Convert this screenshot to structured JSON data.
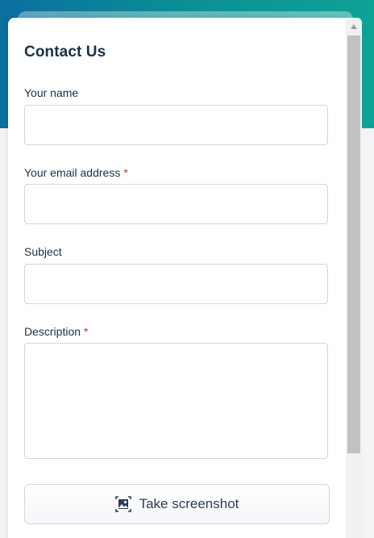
{
  "form": {
    "title": "Contact Us",
    "fields": {
      "name": {
        "label": "Your name",
        "required": false,
        "value": ""
      },
      "email": {
        "label": "Your email address",
        "required": true,
        "required_marker": "*",
        "value": ""
      },
      "subject": {
        "label": "Subject",
        "required": false,
        "value": ""
      },
      "description": {
        "label": "Description",
        "required": true,
        "required_marker": "*",
        "value": ""
      }
    },
    "screenshot_button": {
      "label": "Take screenshot",
      "icon": "image-capture-icon"
    }
  },
  "colors": {
    "header_gradient_start": "#0b6fa0",
    "header_gradient_end": "#0ea397",
    "text": "#183247",
    "required": "#d72d30",
    "border": "#cfd7df"
  }
}
